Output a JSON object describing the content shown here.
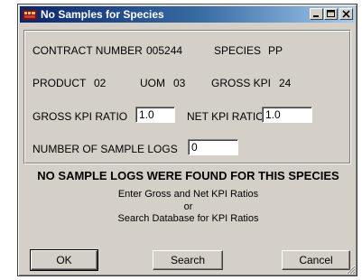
{
  "window": {
    "title": "No Samples for Species"
  },
  "form": {
    "contract_number_label": "CONTRACT NUMBER",
    "contract_number_value": "005244",
    "species_label": "SPECIES",
    "species_value": "PP",
    "product_label": "PRODUCT",
    "product_value": "02",
    "uom_label": "UOM",
    "uom_value": "03",
    "gross_kpi_label": "GROSS KPI",
    "gross_kpi_value": "24",
    "gross_kpi_ratio_label": "GROSS KPI RATIO",
    "gross_kpi_ratio_value": "1.0",
    "net_kpi_ratio_label": "NET KPI RATIO",
    "net_kpi_ratio_value": "1.0",
    "sample_logs_label": "NUMBER OF SAMPLE LOGS",
    "sample_logs_value": "0"
  },
  "message": {
    "headline": "NO SAMPLE LOGS WERE FOUND FOR THIS SPECIES",
    "line1": "Enter Gross and Net KPI Ratios",
    "line2": "or",
    "line3": "Search Database for KPI Ratios"
  },
  "buttons": {
    "ok": "OK",
    "search": "Search",
    "cancel": "Cancel"
  },
  "colors": {
    "titlebar_start": "#0a246a",
    "titlebar_end": "#a6caf0",
    "face": "#d4d0c8"
  },
  "icons": {
    "app": "app-icon",
    "minimize": "minimize-icon",
    "maximize": "maximize-icon",
    "close": "close-icon",
    "grip": "resize-grip-icon"
  }
}
